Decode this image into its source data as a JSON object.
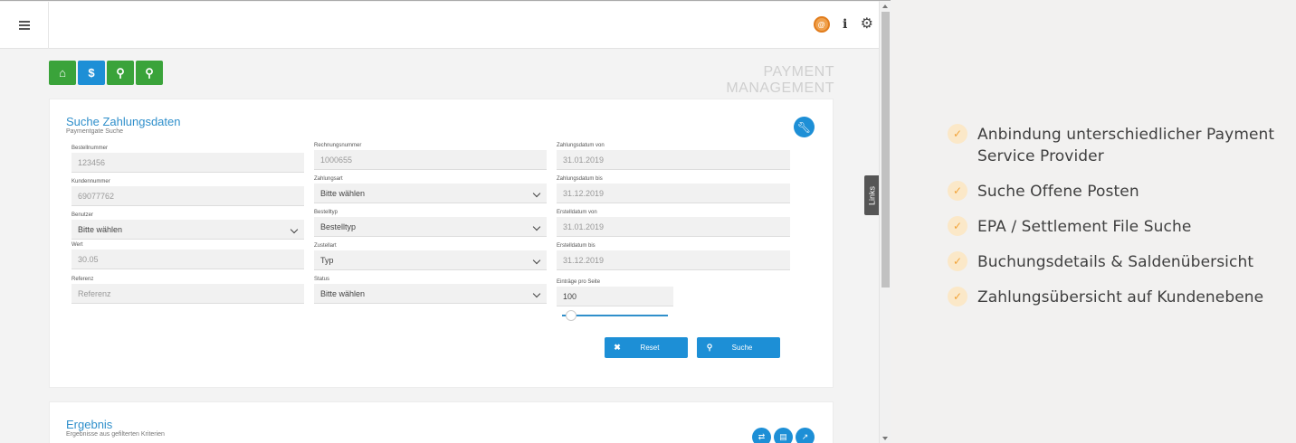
{
  "header": {
    "menu_icon": "hamburger-icon",
    "icons": [
      "logo-icon",
      "info-icon",
      "gear-icon"
    ]
  },
  "toolbar": {
    "buttons": [
      {
        "icon": "home-icon",
        "color": "#3aa33a",
        "glyph": "⌂"
      },
      {
        "icon": "dollar-icon",
        "color": "#1d8fd6",
        "glyph": "$"
      },
      {
        "icon": "search-icon",
        "color": "#3aa33a",
        "glyph": "⚲"
      },
      {
        "icon": "search-icon",
        "color": "#3aa33a",
        "glyph": "⚲"
      }
    ],
    "page_title": "PAYMENT MANAGEMENT"
  },
  "links_tab": "Links",
  "search_card": {
    "title": "Suche Zahlungsdaten",
    "subtitle": "Paymentgate Suche",
    "col1": [
      {
        "label": "Bestellnummer",
        "value": "123456"
      },
      {
        "label": "Kundennummer",
        "value": "69077762"
      },
      {
        "label": "Benutzer",
        "value": "Bitte wählen"
      },
      {
        "label": "Wert",
        "value": "30.05"
      },
      {
        "label": "Referenz",
        "value": "Referenz"
      }
    ],
    "col2": [
      {
        "label": "Rechnungsnummer",
        "value": "1000655"
      },
      {
        "label": "Zahlungsart",
        "value": "Bitte wählen"
      },
      {
        "label": "Bestelltyp",
        "value": "Bestelltyp"
      },
      {
        "label": "Zustellart",
        "value": "Typ"
      },
      {
        "label": "Status",
        "value": "Bitte wählen"
      }
    ],
    "col3": [
      {
        "label": "Zahlungsdatum von",
        "value": "31.01.2019"
      },
      {
        "label": "Zahlungsdatum bis",
        "value": "31.12.2019"
      },
      {
        "label": "Erstelldatum von",
        "value": "31.01.2019"
      },
      {
        "label": "Erstelldatum bis",
        "value": "31.12.2019"
      },
      {
        "label": "Einträge pro Seite",
        "value": "100"
      }
    ],
    "reset_label": "Reset",
    "search_label": "Suche"
  },
  "result_card": {
    "title": "Ergebnis",
    "subtitle": "Ergebnisse aus gefilterten Kriterien"
  },
  "features": [
    "Anbindung unterschiedlicher Payment Service Provider",
    "Suche Offene Posten",
    "EPA / Settlement File Suche",
    "Buchungsdetails & Saldenübersicht",
    "Zahlungsübersicht auf Kundenebene"
  ],
  "colors": {
    "accent_blue": "#1d8fd6",
    "accent_green": "#3aa33a",
    "check_orange": "#f2a43a"
  }
}
